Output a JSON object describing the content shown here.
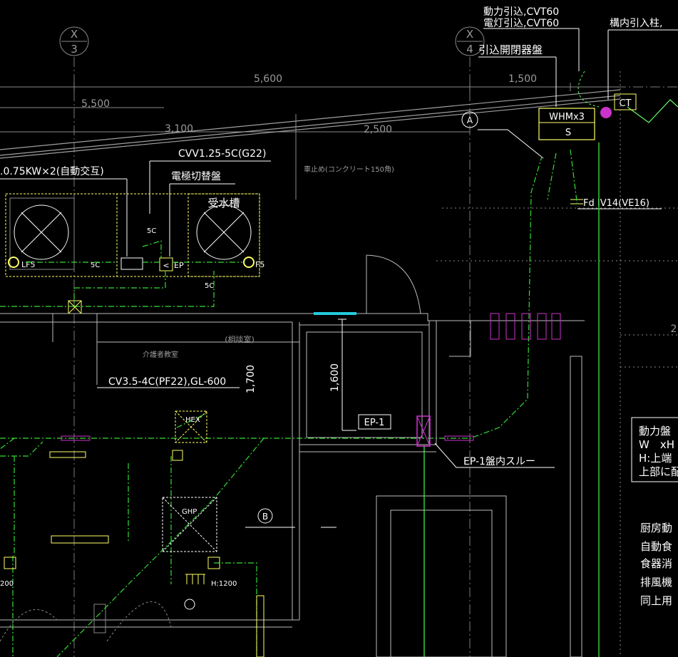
{
  "grid": {
    "x3_top": "X",
    "x3_num": "3",
    "x4_top": "X",
    "x4_num": "4"
  },
  "dims": {
    "d5600": "5,600",
    "d1500": "1,500",
    "d5500": "5,500",
    "d3100": "3,100",
    "d2500": "2,500",
    "d1700": "1,700",
    "d1600": "1,600",
    "d2": "2"
  },
  "labels": {
    "power_in": "動力引込,CVT60",
    "light_in": "電灯引込,CVT60",
    "site_in": "構内引入柱,",
    "main_panel": "引込開閉器盤",
    "ct": "CT",
    "whm": "WHMx3",
    "s": "S",
    "bubble_a": "A",
    "bubble_b": "B",
    "cvv": "CVV1.25-5C(G22)",
    "pump": ".0.75KW×2(自動交互)",
    "electrode": "電極切替盤",
    "tank": "受水槽",
    "car_stop": "車止め(コンクリート150角)",
    "fd": "Fd IV14(VE16)",
    "c5_1": "5C",
    "c5_2": "5C",
    "c5_3": "5C",
    "lf5_l": "LF5",
    "lf5_r": "F5",
    "ep_small": "EP",
    "consult": "(相談室)",
    "caregiver": "介護者教室",
    "cv": "CV3.5-4C(PF22),GL-600",
    "hex": "HEX",
    "ghp": "GHP",
    "ep1": "EP-1",
    "ep1_through": "EP-1盤内スルー",
    "h1200": "H:1200",
    "n200": "200"
  },
  "notes": [
    "動力盤",
    "W　xH",
    "H:上端",
    "上部に配"
  ],
  "notes2": [
    "厨房動",
    "自動食",
    "食器消",
    "排風機",
    "同上用"
  ]
}
